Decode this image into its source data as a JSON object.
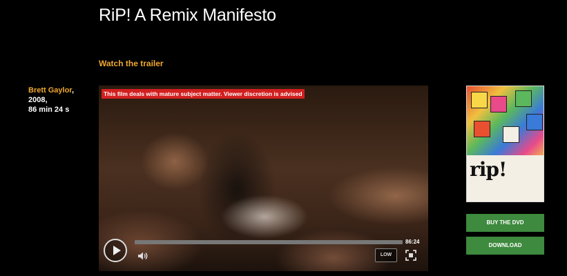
{
  "page": {
    "title": "RiP! A Remix Manifesto",
    "trailer_link": "Watch the trailer"
  },
  "meta": {
    "director": "Brett Gaylor",
    "director_suffix": ",",
    "year": "2008,",
    "duration": "86 min 24 s"
  },
  "player": {
    "warning": "This film deals with mature subject matter. Viewer discretion is advised",
    "time": "86:24",
    "quality": "LOW",
    "progress": 0,
    "icons": {
      "play": "play-icon",
      "volume": "volume-icon",
      "fullscreen": "fullscreen-icon"
    }
  },
  "poster": {
    "logo_text": "rip!"
  },
  "actions": {
    "buy_label": "BUY THE DVD",
    "download_label": "DOWNLOAD"
  },
  "colors": {
    "accent": "#f0a830",
    "warning_bg": "#d21f1f",
    "button_bg": "#3e8a3e"
  }
}
